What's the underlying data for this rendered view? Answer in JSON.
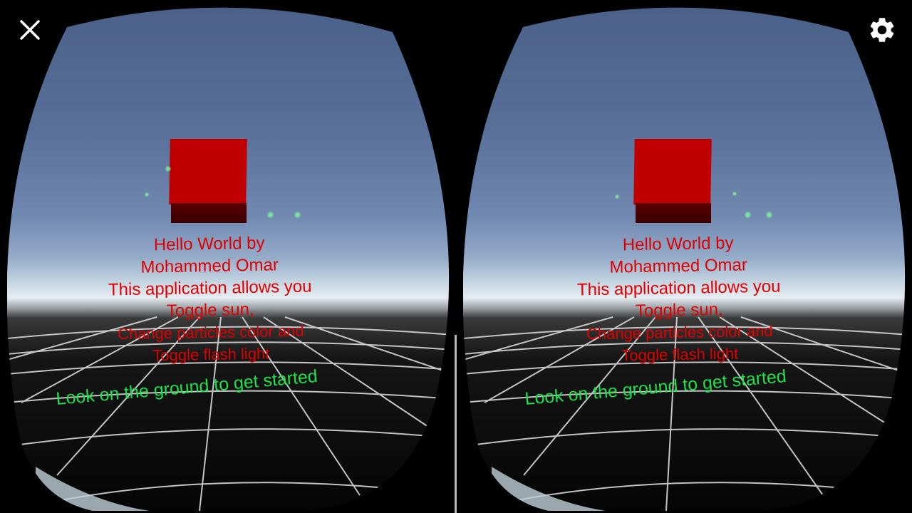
{
  "toolbar": {
    "close_icon": "close-icon",
    "settings_icon": "gear-icon"
  },
  "scene": {
    "info_lines": [
      "Hello World by",
      "Mohammed Omar",
      "This application allows you",
      "Toggle sun,",
      "Change particles color and",
      "Toggle flash light"
    ],
    "prompt": "Look on the ground to get started",
    "cube_color": "#c00000",
    "text_color": "#e00000",
    "prompt_color": "#1ee04a"
  }
}
